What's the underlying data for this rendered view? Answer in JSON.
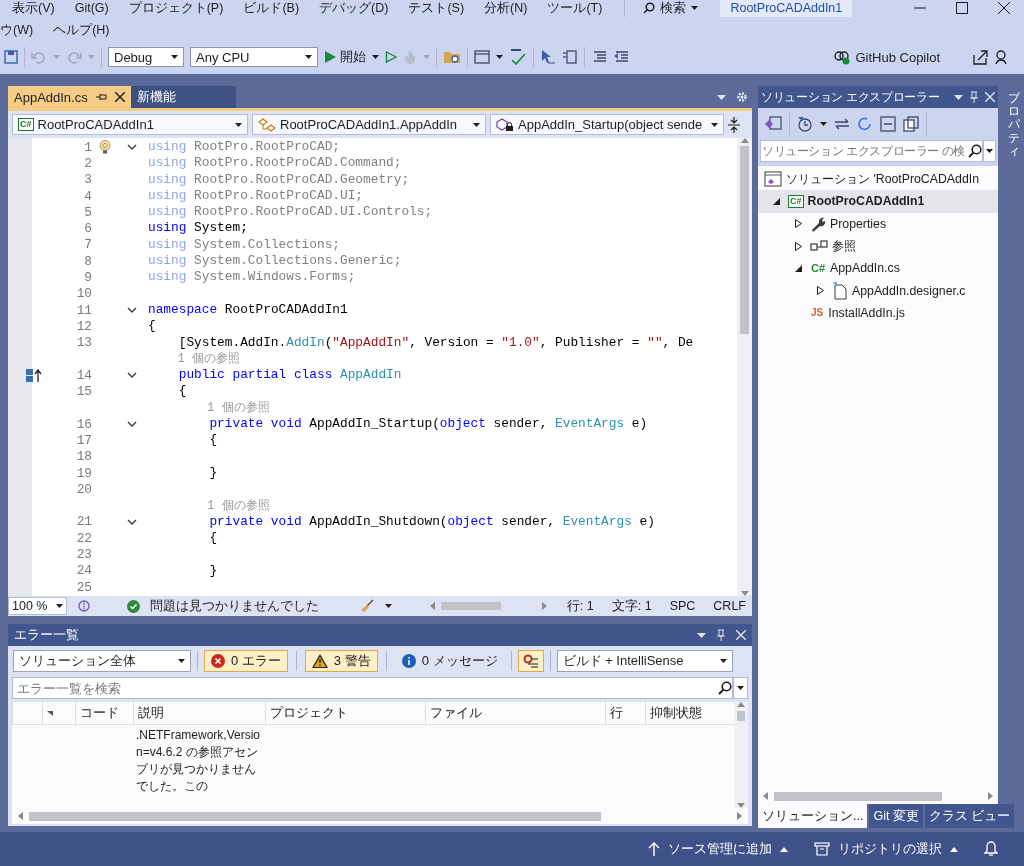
{
  "menu": {
    "rows": [
      [
        "表示(V)",
        "Git(G)",
        "プロジェクト(P)",
        "ビルド(B)",
        "デバッグ(D)",
        "テスト(S)",
        "分析(N)",
        "ツール(T)"
      ],
      [
        "ウ(W)",
        "ヘルプ(H)"
      ]
    ],
    "search": "検索",
    "title": "RootProCADAddIn1"
  },
  "toolbar": {
    "configuration": "Debug",
    "platform": "Any CPU",
    "start": "開始",
    "copilot": "GitHub Copilot"
  },
  "editor": {
    "tabs": [
      {
        "label": "AppAddIn.cs",
        "selected": true
      },
      {
        "label": "新機能",
        "selected": false
      }
    ],
    "nav": [
      {
        "badge": "C#",
        "label": "RootProCADAddIn1"
      },
      {
        "label": "RootProCADAddIn1.AppAddIn"
      },
      {
        "label": "AppAddIn_Startup(object sende"
      }
    ],
    "lines": [
      {
        "kind": "code",
        "number": "1",
        "fold": true,
        "glyph": {
          "kind": "lightbulb"
        },
        "tokens": [
          {
            "kind": "kwdim",
            "text": "using"
          },
          {
            "kind": "dim",
            "text": " RootPro.RootProCAD;"
          }
        ]
      },
      {
        "kind": "code",
        "number": "2",
        "fold": false,
        "tokens": [
          {
            "kind": "kwdim",
            "text": "using"
          },
          {
            "kind": "dim",
            "text": " RootPro.RootProCAD.Command;"
          }
        ]
      },
      {
        "kind": "code",
        "number": "3",
        "fold": false,
        "tokens": [
          {
            "kind": "kwdim",
            "text": "using"
          },
          {
            "kind": "dim",
            "text": " RootPro.RootProCAD.Geometry;"
          }
        ]
      },
      {
        "kind": "code",
        "number": "4",
        "fold": false,
        "tokens": [
          {
            "kind": "kwdim",
            "text": "using"
          },
          {
            "kind": "dim",
            "text": " RootPro.RootProCAD.UI;"
          }
        ]
      },
      {
        "kind": "code",
        "number": "5",
        "fold": false,
        "tokens": [
          {
            "kind": "kwdim",
            "text": "using"
          },
          {
            "kind": "dim",
            "text": " RootPro.RootProCAD.UI.Controls;"
          }
        ]
      },
      {
        "kind": "code",
        "number": "6",
        "fold": false,
        "tokens": [
          {
            "kind": "kw",
            "text": "using"
          },
          {
            "kind": "plain",
            "text": " System;"
          }
        ]
      },
      {
        "kind": "code",
        "number": "7",
        "fold": false,
        "tokens": [
          {
            "kind": "kwdim",
            "text": "using"
          },
          {
            "kind": "dim",
            "text": " System.Collections;"
          }
        ]
      },
      {
        "kind": "code",
        "number": "8",
        "fold": false,
        "tokens": [
          {
            "kind": "kwdim",
            "text": "using"
          },
          {
            "kind": "dim",
            "text": " System.Collections.Generic;"
          }
        ]
      },
      {
        "kind": "code",
        "number": "9",
        "fold": false,
        "tokens": [
          {
            "kind": "kwdim",
            "text": "using"
          },
          {
            "kind": "dim",
            "text": " System.Windows.Forms;"
          }
        ]
      },
      {
        "kind": "code",
        "number": "10",
        "fold": false
      },
      {
        "kind": "code",
        "number": "11",
        "fold": true,
        "tokens": [
          {
            "kind": "kw",
            "text": "namespace"
          },
          {
            "kind": "plain",
            "text": " RootProCADAddIn1"
          }
        ]
      },
      {
        "kind": "code",
        "number": "12",
        "fold": false,
        "tokens": [
          {
            "kind": "plain",
            "text": "{"
          }
        ]
      },
      {
        "kind": "code",
        "number": "13",
        "fold": false,
        "tokens": [
          {
            "kind": "plain",
            "text": "    [System.AddIn."
          },
          {
            "kind": "type",
            "text": "AddIn"
          },
          {
            "kind": "plain",
            "text": "("
          },
          {
            "kind": "str",
            "text": "\"AppAddIn\""
          },
          {
            "kind": "plain",
            "text": ", Version = "
          },
          {
            "kind": "str",
            "text": "\"1.0\""
          },
          {
            "kind": "plain",
            "text": ", Publisher = "
          },
          {
            "kind": "str",
            "text": "\"\""
          },
          {
            "kind": "plain",
            "text": ", De"
          }
        ]
      },
      {
        "kind": "lens",
        "text": "    1 個の参照"
      },
      {
        "kind": "code",
        "number": "14",
        "fold": true,
        "glyph": {
          "kind": "implements"
        },
        "tokens": [
          {
            "kind": "kw",
            "text": "    public partial class"
          },
          {
            "kind": "type",
            "text": " AppAddIn"
          }
        ]
      },
      {
        "kind": "code",
        "number": "15",
        "fold": false,
        "tokens": [
          {
            "kind": "plain",
            "text": "    {"
          }
        ]
      },
      {
        "kind": "lens",
        "text": "        1 個の参照"
      },
      {
        "kind": "code",
        "number": "16",
        "fold": true,
        "tokens": [
          {
            "kind": "kw",
            "text": "        private void"
          },
          {
            "kind": "plain",
            "text": " AppAddIn_Startup("
          },
          {
            "kind": "kw",
            "text": "object"
          },
          {
            "kind": "plain",
            "text": " sender, "
          },
          {
            "kind": "type",
            "text": "EventArgs"
          },
          {
            "kind": "plain",
            "text": " e)"
          }
        ]
      },
      {
        "kind": "code",
        "number": "17",
        "fold": false,
        "tokens": [
          {
            "kind": "plain",
            "text": "        {"
          }
        ]
      },
      {
        "kind": "code",
        "number": "18",
        "fold": false
      },
      {
        "kind": "code",
        "number": "19",
        "fold": false,
        "tokens": [
          {
            "kind": "plain",
            "text": "        }"
          }
        ]
      },
      {
        "kind": "code",
        "number": "20",
        "fold": false
      },
      {
        "kind": "lens",
        "text": "        1 個の参照"
      },
      {
        "kind": "code",
        "number": "21",
        "fold": true,
        "tokens": [
          {
            "kind": "kw",
            "text": "        private void"
          },
          {
            "kind": "plain",
            "text": " AppAddIn_Shutdown("
          },
          {
            "kind": "kw",
            "text": "object"
          },
          {
            "kind": "plain",
            "text": " sender, "
          },
          {
            "kind": "type",
            "text": "EventArgs"
          },
          {
            "kind": "plain",
            "text": " e)"
          }
        ]
      },
      {
        "kind": "code",
        "number": "22",
        "fold": false,
        "tokens": [
          {
            "kind": "plain",
            "text": "        {"
          }
        ]
      },
      {
        "kind": "code",
        "number": "23",
        "fold": false
      },
      {
        "kind": "code",
        "number": "24",
        "fold": false,
        "tokens": [
          {
            "kind": "plain",
            "text": "        }"
          }
        ]
      },
      {
        "kind": "code",
        "number": "25",
        "fold": false
      }
    ],
    "status": {
      "zoom": "100 %",
      "health": "問題は見つかりませんでした",
      "line": "行: 1",
      "char": "文字: 1",
      "indent": "SPC",
      "eol": "CRLF"
    }
  },
  "error_list": {
    "title": "エラー一覧",
    "scope": "ソリューション全体",
    "filters": [
      {
        "kind": "error",
        "label": "0 エラー",
        "selected": true
      },
      {
        "kind": "warning",
        "label": "3 警告",
        "selected": true
      },
      {
        "kind": "message",
        "label": "0 メッセージ",
        "selected": false
      }
    ],
    "project_filter": {
      "selected": true
    },
    "source": "ビルド + IntelliSense",
    "search": {
      "placeholder": "エラー一覧を検索"
    },
    "columns": [
      "コード",
      "説明",
      "プロジェクト",
      "ファイル",
      "行",
      "抑制状態"
    ],
    "rows": [
      {
        "description": ".NETFramework,Version=v4.6.2 の参照アセンブリが見つかりませんでした。この"
      }
    ]
  },
  "solution_explorer": {
    "title": "ソリューション エクスプローラー",
    "search": {
      "placeholder": "ソリューション エクスプローラー の検"
    },
    "tree": [
      {
        "kind": "solution",
        "label": "ソリューション 'RootProCADAddIn",
        "selected": false,
        "children": [
          {
            "kind": "project",
            "badge": "C#",
            "label": "RootProCADAddIn1",
            "expanded": true,
            "selected": true,
            "children": [
              {
                "kind": "properties",
                "label": "Properties",
                "expanded": false,
                "selected": false
              },
              {
                "kind": "references",
                "label": "参照",
                "expanded": false,
                "selected": false
              },
              {
                "kind": "csharp",
                "badge": "C#",
                "label": "AppAddIn.cs",
                "expanded": true,
                "selected": false,
                "children": [
                  {
                    "kind": "file",
                    "label": "AppAddIn.designer.c",
                    "expanded": false,
                    "selected": false
                  }
                ]
              },
              {
                "kind": "javascript",
                "badge": "JS",
                "label": "InstallAddIn.js",
                "selected": false
              }
            ]
          }
        ]
      }
    ],
    "tabs": [
      {
        "label": "ソリューション...",
        "selected": true
      },
      {
        "label": "Git 変更",
        "selected": false
      },
      {
        "label": "クラス ビュー",
        "selected": false
      }
    ]
  },
  "properties_strip": "プロパティ",
  "status_bar": {
    "items": [
      {
        "kind": "source-control",
        "label": "ソース管理に追加"
      },
      {
        "kind": "repository",
        "label": "リポジトリの選択"
      }
    ]
  }
}
